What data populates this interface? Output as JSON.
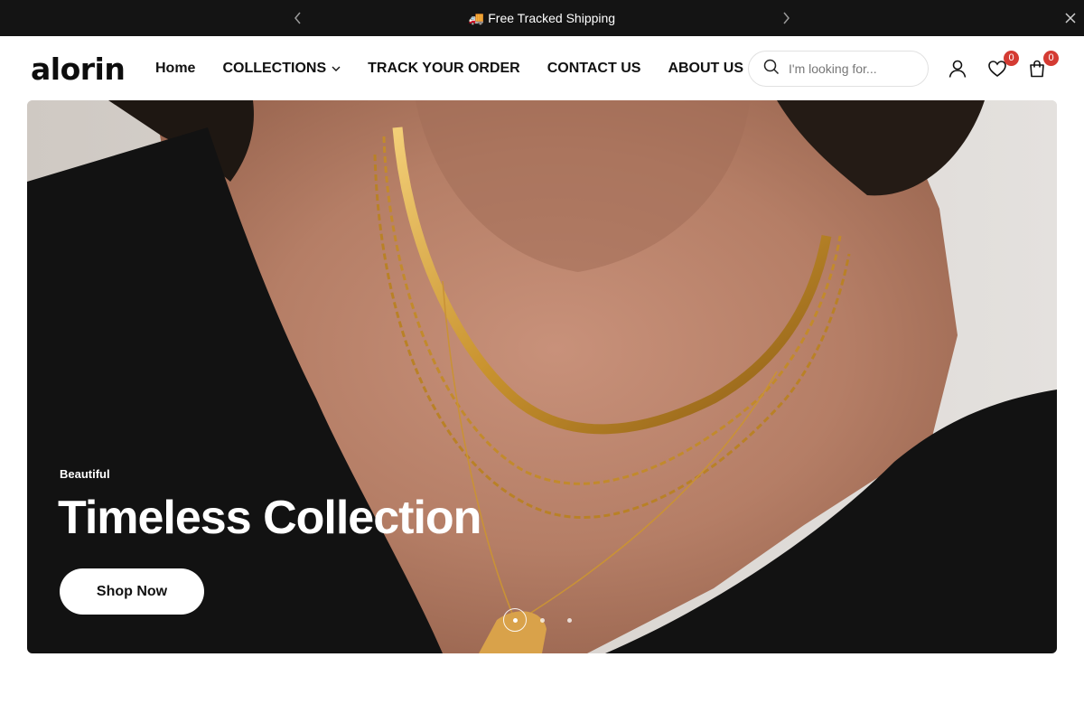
{
  "announcement": {
    "message": "🚚 Free Tracked Shipping"
  },
  "header": {
    "logo": "alorin",
    "nav": [
      {
        "label": "Home"
      },
      {
        "label": "COLLECTIONS"
      },
      {
        "label": "TRACK YOUR ORDER"
      },
      {
        "label": "CONTACT US"
      },
      {
        "label": "ABOUT US"
      }
    ],
    "search": {
      "placeholder": "I'm looking for..."
    },
    "wishlist_count": "0",
    "cart_count": "0"
  },
  "hero": {
    "eyebrow": "Beautiful",
    "headline": "Timeless Collection",
    "cta_label": "Shop Now",
    "slides_total": 3,
    "active_slide": 1
  },
  "colors": {
    "announcement_bg": "#141414",
    "badge": "#d43b33",
    "text": "#111111"
  }
}
